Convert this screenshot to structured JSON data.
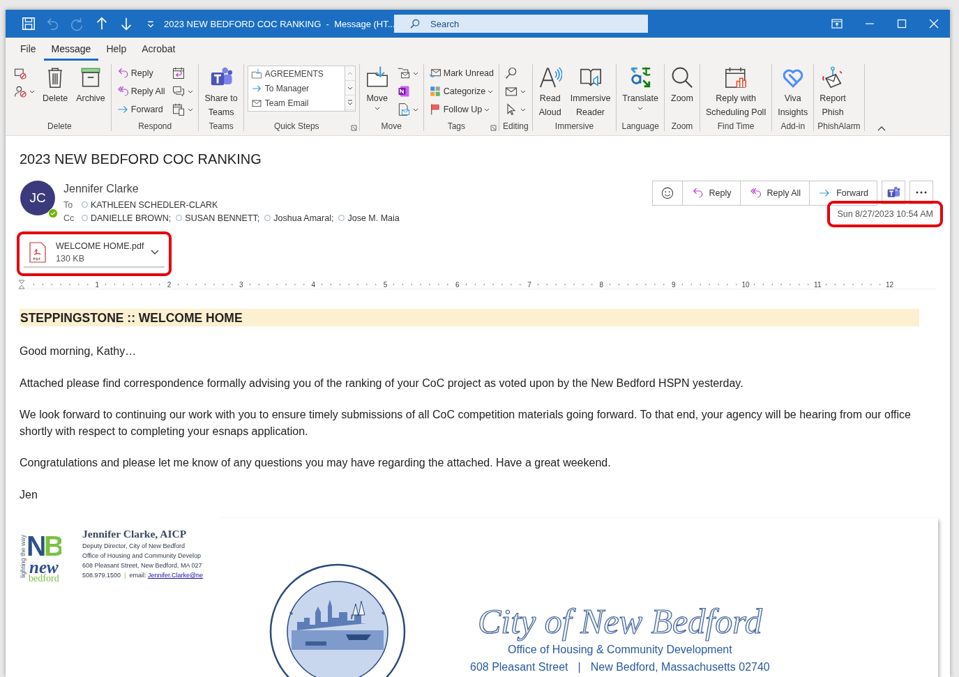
{
  "window": {
    "title": "2023 NEW BEDFORD COC RANKING  -  Message (HT...",
    "search": {
      "placeholder": "Search"
    },
    "quick_access": [
      {
        "kind": "save",
        "disabled": false
      },
      {
        "kind": "undo",
        "disabled": true
      },
      {
        "kind": "redo",
        "disabled": true
      },
      {
        "kind": "up",
        "disabled": false
      },
      {
        "kind": "down",
        "disabled": false
      },
      {
        "kind": "customize",
        "disabled": false
      }
    ]
  },
  "menu_tabs": [
    {
      "label": "File",
      "selected": false
    },
    {
      "label": "Message",
      "selected": true
    },
    {
      "label": "Help",
      "selected": false
    },
    {
      "label": "Acrobat",
      "selected": false
    }
  ],
  "ribbon": {
    "groups": [
      {
        "label": "Delete",
        "launcher": false,
        "columns": [
          [
            {
              "kind": "icon",
              "dropdown": false
            },
            {
              "kind": "icon",
              "dropdown": true
            }
          ],
          [
            {
              "kind": "large",
              "lines": [
                "Delete"
              ],
              "dropdown": false
            }
          ],
          [
            {
              "kind": "large",
              "lines": [
                "Archive"
              ],
              "dropdown": false
            }
          ]
        ]
      },
      {
        "label": "Respond",
        "launcher": false,
        "columns": [
          [
            {
              "kind": "small",
              "label": "Reply",
              "dropdown": false
            },
            {
              "kind": "small",
              "label": "Reply All",
              "dropdown": false
            },
            {
              "kind": "small",
              "label": "Forward",
              "dropdown": false
            }
          ],
          [
            {
              "kind": "icon",
              "dropdown": false
            },
            {
              "kind": "icon",
              "dropdown": true
            },
            {
              "kind": "icon",
              "dropdown": true
            }
          ]
        ]
      },
      {
        "label": "Teams",
        "launcher": false,
        "columns": [
          [
            {
              "kind": "large",
              "lines": [
                "Share to",
                "Teams"
              ],
              "dropdown": false
            }
          ]
        ]
      },
      {
        "label": "Quick Steps",
        "launcher": true,
        "columns": [
          [
            {
              "kind": "gallery",
              "entries": [
                "AGREEMENTS",
                "To Manager",
                "Team Email"
              ]
            }
          ]
        ]
      },
      {
        "label": "Move",
        "launcher": false,
        "columns": [
          [
            {
              "kind": "large",
              "lines": [
                "Move"
              ],
              "dropdown": true
            }
          ],
          [
            {
              "kind": "icon",
              "dropdown": true
            },
            {
              "kind": "icon",
              "dropdown": false
            },
            {
              "kind": "icon",
              "dropdown": true
            }
          ]
        ]
      },
      {
        "label": "Tags",
        "launcher": true,
        "columns": [
          [
            {
              "kind": "small",
              "label": "Mark Unread",
              "dropdown": false
            },
            {
              "kind": "small",
              "label": "Categorize",
              "dropdown": true
            },
            {
              "kind": "small",
              "label": "Follow Up",
              "dropdown": true
            }
          ]
        ]
      },
      {
        "label": "Editing",
        "launcher": false,
        "columns": [
          [
            {
              "kind": "icon",
              "dropdown": false
            },
            {
              "kind": "icon",
              "dropdown": true
            },
            {
              "kind": "icon",
              "dropdown": true
            }
          ]
        ]
      },
      {
        "label": "Immersive",
        "launcher": false,
        "columns": [
          [
            {
              "kind": "large",
              "lines": [
                "Read",
                "Aloud"
              ],
              "dropdown": false
            }
          ],
          [
            {
              "kind": "large",
              "lines": [
                "Immersive",
                "Reader"
              ],
              "dropdown": false
            }
          ]
        ]
      },
      {
        "label": "Language",
        "launcher": false,
        "columns": [
          [
            {
              "kind": "large",
              "lines": [
                "Translate"
              ],
              "dropdown": true
            }
          ]
        ]
      },
      {
        "label": "Zoom",
        "launcher": false,
        "columns": [
          [
            {
              "kind": "large",
              "lines": [
                "Zoom"
              ],
              "dropdown": false
            }
          ]
        ]
      },
      {
        "label": "Find Time",
        "launcher": false,
        "columns": [
          [
            {
              "kind": "large",
              "lines": [
                "Reply with",
                "Scheduling Poll"
              ],
              "dropdown": false
            }
          ]
        ]
      },
      {
        "label": "Add-in",
        "launcher": false,
        "columns": [
          [
            {
              "kind": "large",
              "lines": [
                "Viva",
                "Insights"
              ],
              "dropdown": false
            }
          ]
        ]
      },
      {
        "label": "PhishAlarm",
        "launcher": false,
        "columns": [
          [
            {
              "kind": "large",
              "lines": [
                "Report",
                "Phish"
              ],
              "dropdown": false
            }
          ]
        ]
      }
    ]
  },
  "message": {
    "subject": "2023 NEW BEDFORD COC RANKING",
    "sender": {
      "initials": "JC",
      "name": "Jennifer Clarke",
      "online": true
    },
    "to": {
      "label": "To",
      "recipients": [
        "KATHLEEN SCHEDLER-CLARK"
      ]
    },
    "cc": {
      "label": "Cc",
      "recipients": [
        "DANIELLE BROWN;",
        "SUSAN BENNETT;",
        "Joshua Amaral;",
        "Jose M. Maia"
      ]
    },
    "actions": [
      {
        "kind": "emoji"
      },
      {
        "kind": "reply",
        "label": "Reply"
      },
      {
        "kind": "reply-all",
        "label": "Reply All"
      },
      {
        "kind": "forward",
        "label": "Forward"
      },
      {
        "kind": "teams"
      },
      {
        "kind": "more"
      }
    ],
    "date": {
      "text": "Sun 8/27/2023 10:54 AM",
      "highlighted": true
    },
    "attachment": {
      "name": "WELCOME HOME.pdf",
      "size": "130 KB",
      "highlighted": true
    }
  },
  "ruler": {
    "marks": [
      "1",
      "2",
      "3",
      "4",
      "5",
      "6",
      "7",
      "8",
      "9",
      "10",
      "11",
      "12"
    ]
  },
  "body": {
    "banner": "STEPPINGSTONE :: WELCOME HOME",
    "paragraphs": [
      "Good morning, Kathy…",
      "Attached please find correspondence formally advising you of the ranking of your CoC project as voted upon by the New Bedford HSPN yesterday.",
      "We look forward to continuing our work with you to ensure timely submissions of all CoC competition materials going forward. To that end, your agency will be hearing from our office shortly with respect to completing your esnaps application.",
      "Congratulations and please let me know of any questions you may have regarding the attached.  Have a great weekend.",
      "Jen"
    ]
  },
  "signature": {
    "logo": {
      "tagline": "lighting the way",
      "initials": "NB",
      "word1": "new",
      "word2": "bedford"
    },
    "name": "Jennifer Clarke, AICP",
    "lines": [
      "Deputy Director, City of New Bedford",
      "Office of Housing and Community Develop",
      "608 Pleasant Street, New Bedford, MA 027"
    ],
    "phone": "508.979.1500",
    "separator": "|",
    "email_label": "email:",
    "email": "Jennifer.Clarke@ne"
  },
  "letterhead": {
    "title": "City of New Bedford",
    "office": "Office of Housing & Community Development",
    "street": "608 Pleasant Street",
    "separator": "|",
    "city": "New Bedford, Massachusetts 02740"
  }
}
